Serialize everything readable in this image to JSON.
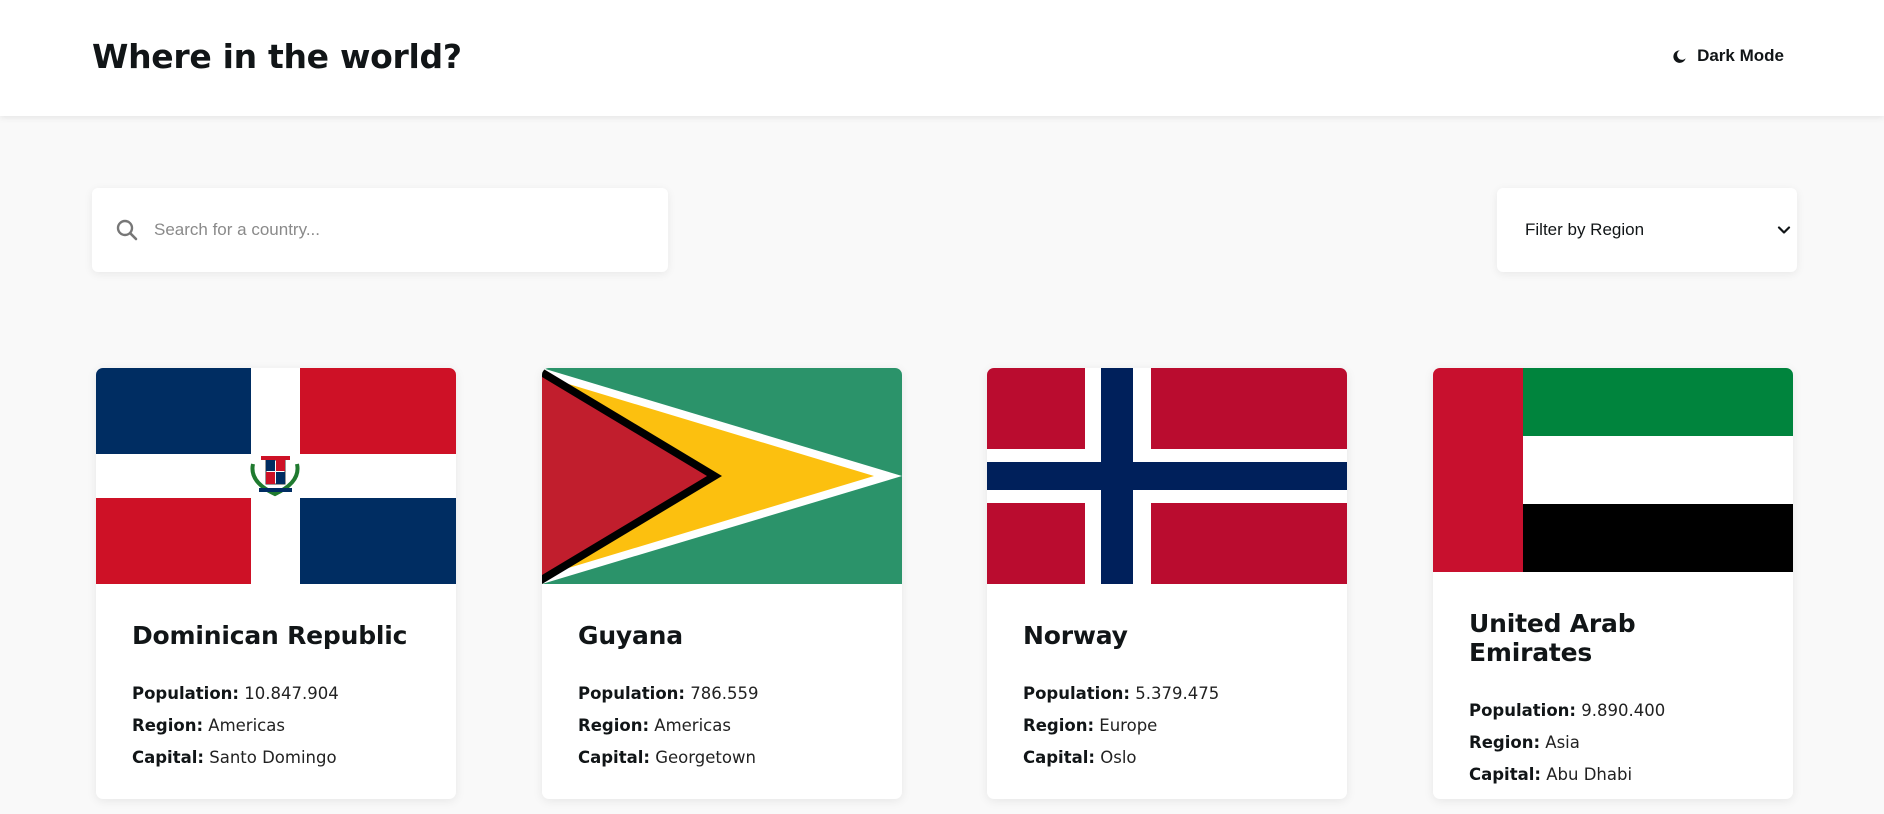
{
  "header": {
    "title": "Where in the world?",
    "theme_toggle_label": "Dark Mode",
    "theme_icon": "moon-icon"
  },
  "search": {
    "placeholder": "Search for a country...",
    "value": "",
    "icon": "search-icon"
  },
  "filter": {
    "label": "Filter by Region",
    "icon": "chevron-down-icon"
  },
  "labels": {
    "population": "Population:",
    "region": "Region:",
    "capital": "Capital:"
  },
  "countries": [
    {
      "name": "Dominican Republic",
      "population": "10.847.904",
      "region": "Americas",
      "capital": "Santo Domingo",
      "flag": "dominican-republic-flag"
    },
    {
      "name": "Guyana",
      "population": "786.559",
      "region": "Americas",
      "capital": "Georgetown",
      "flag": "guyana-flag"
    },
    {
      "name": "Norway",
      "population": "5.379.475",
      "region": "Europe",
      "capital": "Oslo",
      "flag": "norway-flag"
    },
    {
      "name": "United Arab Emirates",
      "population": "9.890.400",
      "region": "Asia",
      "capital": "Abu Dhabi",
      "flag": "united-arab-emirates-flag"
    }
  ],
  "colors": {
    "background": "#f9f9f9",
    "surface": "#ffffff",
    "text": "#111517"
  }
}
